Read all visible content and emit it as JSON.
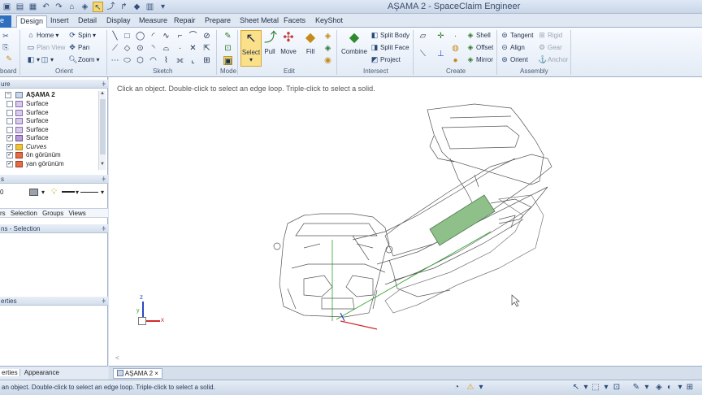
{
  "window": {
    "title": "AŞAMA 2 - SpaceClaim Engineer"
  },
  "ribbon_tabs": [
    {
      "label": "Design",
      "active": true
    },
    {
      "label": "Insert"
    },
    {
      "label": "Detail"
    },
    {
      "label": "Display"
    },
    {
      "label": "Measure"
    },
    {
      "label": "Repair"
    },
    {
      "label": "Prepare"
    },
    {
      "label": "Sheet Metal"
    },
    {
      "label": "Facets"
    },
    {
      "label": "KeyShot"
    }
  ],
  "groups": {
    "clipboard": "board",
    "orient": "Orient",
    "sketch": "Sketch",
    "mode": "Mode",
    "edit": "Edit",
    "intersect": "Intersect",
    "create": "Create",
    "assembly": "Assembly"
  },
  "orient_tools": {
    "home": "Home",
    "spin": "Spin",
    "plan_view": "Plan View",
    "pan": "Pan",
    "zoom": "Zoom"
  },
  "edit_tools": {
    "select": "Select",
    "pull": "Pull",
    "move": "Move",
    "fill": "Fill"
  },
  "intersect_tools": {
    "combine": "Combine",
    "split_body": "Split Body",
    "split_face": "Split Face",
    "project": "Project"
  },
  "create_tools": {
    "shell": "Shell",
    "offset": "Offset",
    "mirror": "Mirror"
  },
  "assembly_tools": {
    "tangent": "Tangent",
    "align": "Align",
    "orient": "Orient",
    "rigid": "Rigid",
    "gear": "Gear",
    "anchor": "Anchor"
  },
  "structure": {
    "header": "ure",
    "root": "AŞAMA 2",
    "items": [
      {
        "label": "Surface",
        "checked": false,
        "italic": false
      },
      {
        "label": "Surface",
        "checked": false,
        "italic": false
      },
      {
        "label": "Surface",
        "checked": false,
        "italic": false
      },
      {
        "label": "Surface",
        "checked": false,
        "italic": false
      },
      {
        "label": "Surface",
        "checked": true,
        "italic": false
      },
      {
        "label": "Curves",
        "checked": true,
        "italic": true
      },
      {
        "label": "ön görünüm",
        "checked": true,
        "italic": false
      },
      {
        "label": "yan görünüm",
        "checked": true,
        "italic": false
      }
    ]
  },
  "layers": {
    "header": "s",
    "value": "0"
  },
  "panel_tabs": [
    "rs",
    "Selection",
    "Groups",
    "Views"
  ],
  "selection_header": "ns - Selection",
  "properties_header": "erties",
  "bottom_tabs": [
    "erties",
    "Appearance"
  ],
  "viewport": {
    "hint": "Click an object. Double-click to select an edge loop. Triple-click to select a solid.",
    "axes": {
      "z": "z",
      "x": "x",
      "y": "y"
    },
    "small_chevron": "<"
  },
  "document_tab": {
    "label": "AŞAMA 2",
    "close": "×"
  },
  "status": {
    "message": "an object. Double-click to select an edge loop. Triple-click to select a solid."
  },
  "colors": {
    "accent": "#2f6fc0",
    "selected_face": "#8fc08a",
    "axis_x": "#d42a2a",
    "axis_y": "#2aa02a",
    "axis_z": "#2a48c8"
  }
}
